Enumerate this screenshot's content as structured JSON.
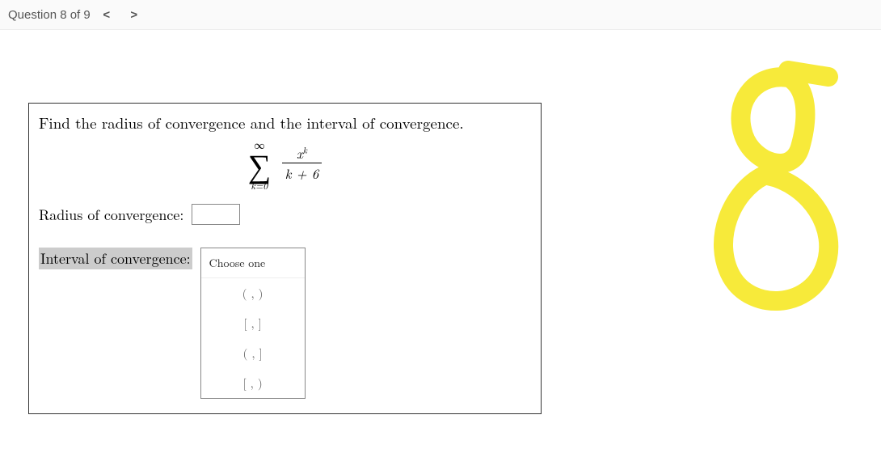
{
  "header": {
    "question_label": "Question 8 of 9",
    "prev_glyph": "<",
    "next_glyph": ">"
  },
  "question": {
    "prompt": "Find the radius of convergence and the interval of convergence.",
    "formula": {
      "upper": "∞",
      "lower": "k=0",
      "numerator_base": "x",
      "numerator_exp": "k",
      "denominator": "k + 6"
    },
    "radius_label": "Radius of convergence:",
    "radius_value": "",
    "interval_label": "Interval of convergence:",
    "dropdown": {
      "placeholder": "Choose one",
      "options": [
        "(   ,   )",
        "[   ,   ]",
        "(   ,   ]",
        "[   ,   )"
      ]
    }
  },
  "annotation": {
    "glyph": "8",
    "stroke_color": "#f7ea3a"
  }
}
